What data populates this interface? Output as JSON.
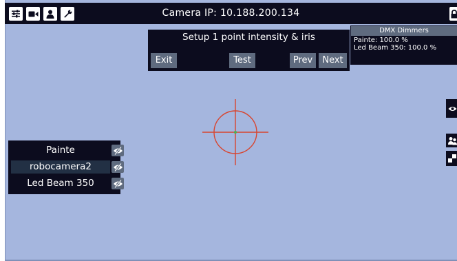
{
  "topbar": {
    "title": "Camera IP: 10.188.200.134",
    "icons": [
      "sliders-icon",
      "video-camera-icon",
      "user-icon",
      "wrench-icon",
      "lock-icon"
    ]
  },
  "setup_panel": {
    "title": "Setup 1 point intensity & iris",
    "exit_label": "Exit",
    "test_label": "Test",
    "prev_label": "Prev",
    "next_label": "Next"
  },
  "dmx_panel": {
    "title": "DMX Dimmers",
    "lines": [
      "Painte: 100.0 %",
      "Led Beam 350: 100.0 %"
    ]
  },
  "fixtures": {
    "items": [
      {
        "name": "Painte",
        "selected": false
      },
      {
        "name": "robocamera2",
        "selected": true
      },
      {
        "name": "Led Beam 350",
        "selected": false
      }
    ]
  },
  "side_tools": {
    "icons": [
      "eye-icon",
      "users-icon",
      "checker-icon"
    ]
  },
  "colors": {
    "canvas": "#a5b6de",
    "panel": "#0c0c1e",
    "button": "#5f6b7f",
    "crosshair": "#d8452f",
    "center_dot": "#4caf50"
  }
}
